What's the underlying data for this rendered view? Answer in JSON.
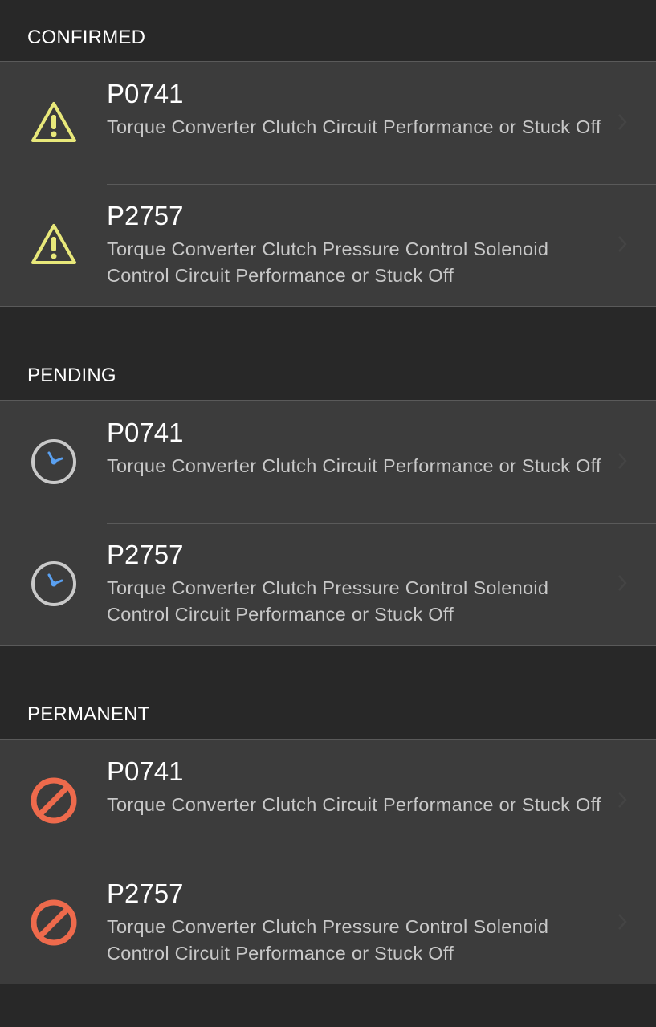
{
  "sections": [
    {
      "title": "CONFIRMED",
      "icon": "warning-triangle-icon",
      "icon_color": "#e8e87a",
      "items": [
        {
          "code": "P0741",
          "description": "Torque Converter Clutch Circuit Performance or Stuck Off"
        },
        {
          "code": "P2757",
          "description": "Torque Converter Clutch Pressure Control Solenoid Control Circuit Performance or Stuck Off"
        }
      ]
    },
    {
      "title": "PENDING",
      "icon": "clock-icon",
      "icon_color": "#5aa0f0",
      "items": [
        {
          "code": "P0741",
          "description": "Torque Converter Clutch Circuit Performance or Stuck Off"
        },
        {
          "code": "P2757",
          "description": "Torque Converter Clutch Pressure Control Solenoid Control Circuit Performance or Stuck Off"
        }
      ]
    },
    {
      "title": "PERMANENT",
      "icon": "prohibited-icon",
      "icon_color": "#ee6a4c",
      "items": [
        {
          "code": "P0741",
          "description": "Torque Converter Clutch Circuit Performance or Stuck Off"
        },
        {
          "code": "P2757",
          "description": "Torque Converter Clutch Pressure Control Solenoid Control Circuit Performance or Stuck Off"
        }
      ]
    }
  ]
}
